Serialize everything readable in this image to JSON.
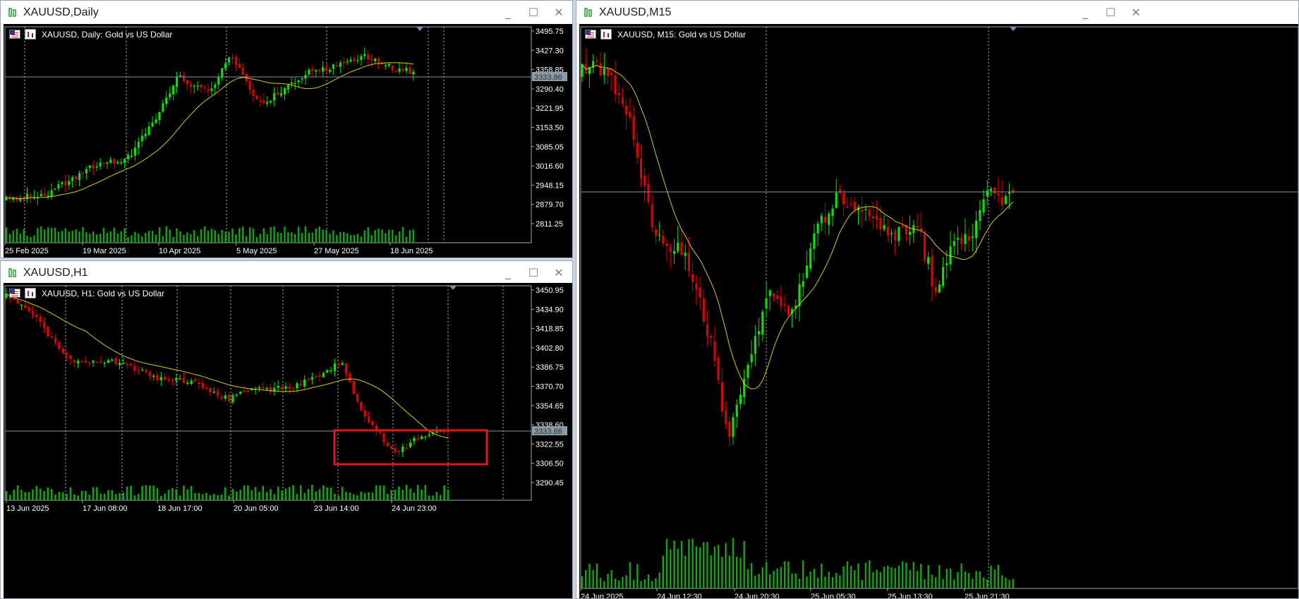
{
  "windows": {
    "daily": {
      "title": "XAUUSD,Daily",
      "symbol_label": "XAUUSD, Daily:  Gold vs US Dollar",
      "price_labels": [
        "3495.75",
        "3427.30",
        "3358.85",
        "3290.40",
        "3221.95",
        "3153.50",
        "3085.05",
        "3016.60",
        "2948.15",
        "2879.70",
        "2811.25"
      ],
      "current_price": "3333.86",
      "date_labels": [
        "25 Feb 2025",
        "19 Mar 2025",
        "10 Apr 2025",
        "5 May 2025",
        "27 May 2025",
        "18 Jun 2025"
      ]
    },
    "h1": {
      "title": "XAUUSD,H1",
      "symbol_label": "XAUUSD, H1:  Gold vs US Dollar",
      "price_labels": [
        "3450.95",
        "3434.90",
        "3418.85",
        "3402.80",
        "3386.75",
        "3370.70",
        "3354.65",
        "3338.60",
        "3322.55",
        "3306.50",
        "3290.45"
      ],
      "current_price": "3333.86",
      "date_labels": [
        "13 Jun 2025",
        "17 Jun 08:00",
        "18 Jun 17:00",
        "20 Jun 05:00",
        "23 Jun 14:00",
        "24 Jun 23:00"
      ]
    },
    "m15": {
      "title": "XAUUSD,M15",
      "symbol_label": "XAUUSD, M15:  Gold vs US Dollar",
      "date_labels": [
        "24 Jun 2025",
        "24 Jun 12:30",
        "24 Jun 20:30",
        "25 Jun 05:30",
        "25 Jun 13:30",
        "25 Jun 21:30"
      ]
    }
  },
  "controls": {
    "minimize": "_",
    "maximize": "☐",
    "close": "✕"
  },
  "colors": {
    "bull": "#00e600",
    "bear": "#e00000",
    "ma": "#d4cc1a",
    "volume": "#10a810",
    "highlight": "#e8151b"
  },
  "icons": {
    "window": "chart-window-icon",
    "flag": "us-flag-icon",
    "chart_type": "candlestick-icon"
  }
}
